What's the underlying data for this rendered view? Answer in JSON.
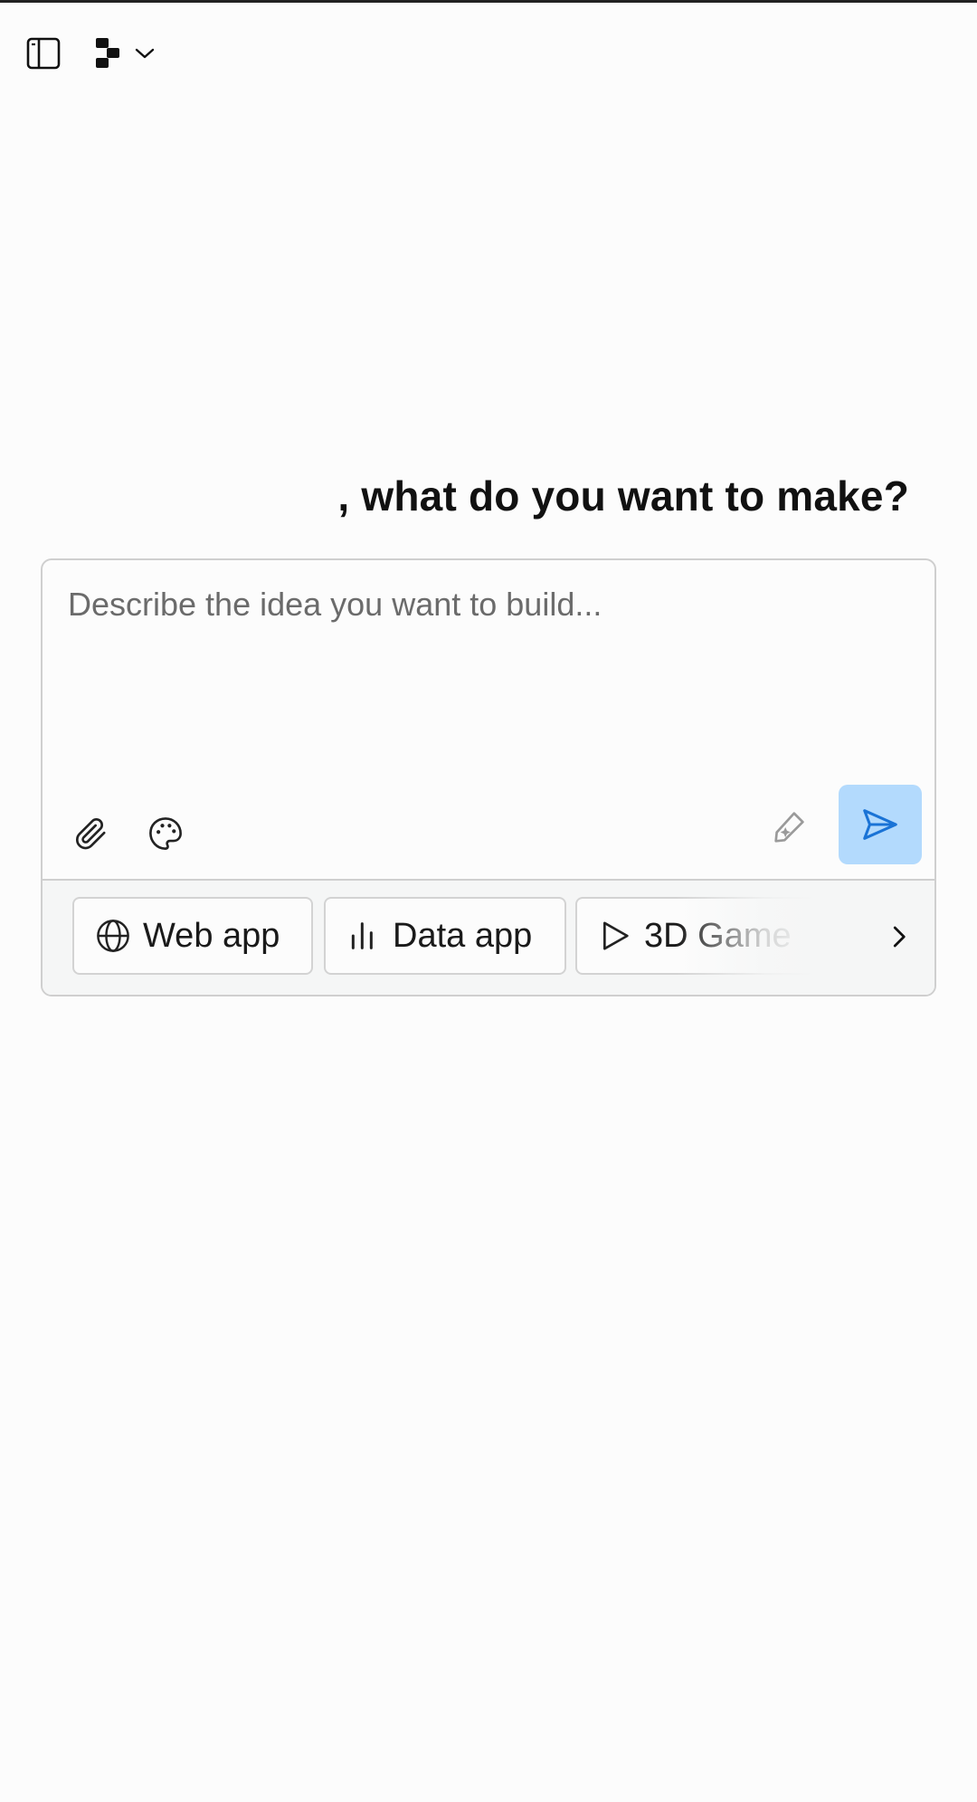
{
  "greeting": {
    "text": ", what do you want to make?"
  },
  "composer": {
    "placeholder": "Describe the idea you want to build..."
  },
  "quick_chips": [
    {
      "label": "Web app",
      "icon": "globe-icon"
    },
    {
      "label": "Data app",
      "icon": "bar-chart-icon"
    },
    {
      "label": "3D Game",
      "icon": "play-icon"
    }
  ],
  "icons": {
    "sidebar": "sidebar-toggle-icon",
    "project": "project-tree-icon",
    "dropdown": "chevron-down-icon",
    "attach": "paperclip-icon",
    "theme": "palette-icon",
    "enhance": "enhance-prompt-icon",
    "send": "send-icon",
    "more": "chevron-right-icon"
  },
  "colors": {
    "send_button_bg": "#b3dafd",
    "send_icon": "#1a73d6",
    "background": "#fcfcfc"
  }
}
